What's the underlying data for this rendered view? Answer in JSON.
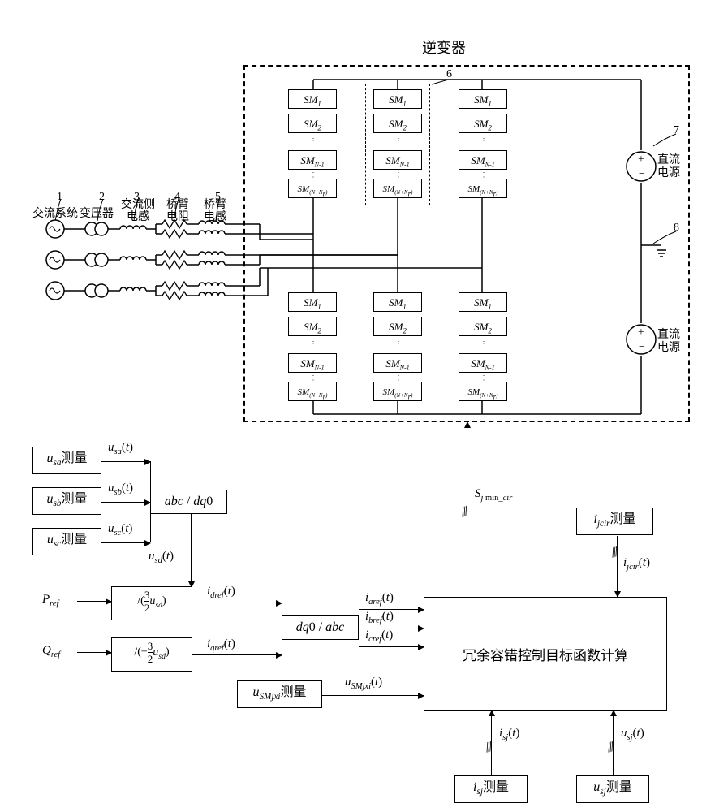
{
  "title": "逆变器",
  "labels": {
    "ac_system": "交流系统",
    "transformer": "变压器",
    "ac_inductor": "交流侧电感",
    "arm_resistor": "桥臂电阻",
    "arm_inductor": "桥臂电感",
    "dc_source": "直流电源"
  },
  "callouts": {
    "c1": "1",
    "c2": "2",
    "c3": "3",
    "c4": "4",
    "c5": "5",
    "c6": "6",
    "c7": "7",
    "c8": "8"
  },
  "sm": {
    "sm1": "SM₁",
    "sm2": "SM₂",
    "smn1": "SM",
    "smn1_sub": "N-1",
    "smnn": "SM",
    "smnn_sub": "(N+Nᵣ)"
  },
  "signals": {
    "usa": "uₛₐ",
    "usb": "u",
    "usc": "u",
    "usa_meas": "测量",
    "usa_t": "uₛₐ(t)",
    "usb_t": "u",
    "usc_t": "u",
    "abc_dq0": "abc / dq0",
    "dq0_abc": "dq0 / abc",
    "usd_t": "u",
    "pref": "P",
    "qref": "Q",
    "div1": "/(3/2 u",
    "div2": "/(-3/2 u",
    "idref": "i",
    "iqref": "i",
    "iaref": "i",
    "ibref": "i",
    "icref": "i",
    "usmjxi": "u",
    "usmjxi_t": "u",
    "sjmin": "S",
    "ijcir": "i",
    "ijcir_t": "i",
    "isj": "i",
    "isj_t": "i",
    "usj": "u",
    "usj_t": "u"
  },
  "big_box": "冗余容错控制目标函数计算",
  "meas": "测量"
}
